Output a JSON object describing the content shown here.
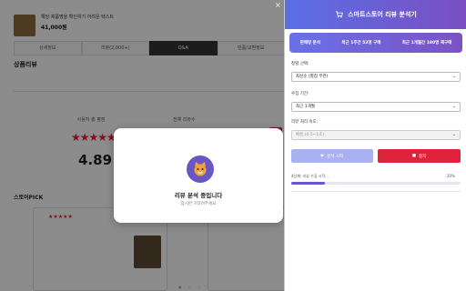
{
  "store": {
    "product_name": "해당 제품명을 확인하기 어려운 텍스트",
    "price": "41,000원",
    "price_sub": "",
    "tabs": [
      {
        "label": "상세정보"
      },
      {
        "label": "리뷰(2,000+)"
      },
      {
        "label": "Q&A"
      },
      {
        "label": "반품/교환정보"
      }
    ],
    "section_title": "상품리뷰",
    "section_desc": "",
    "rating_label": "사용자 총 평점",
    "rating_sub": "",
    "rating_score": "4.89",
    "stars": "★★★★★",
    "distribution_label": "전체 리뷰수",
    "pick_title": "스토어PICK",
    "reviews": [
      {
        "stars": "★★★★★",
        "text": ""
      },
      {
        "stars": "",
        "text": ""
      }
    ]
  },
  "modal": {
    "icon": "cat-icon",
    "title": "리뷰 분석 중입니다",
    "subtitle": "잠시만 기다려주세요"
  },
  "panel": {
    "title": "스마트스토어 리뷰 분석기",
    "header_icon": "cart-icon",
    "stats": [
      "판매량 분석",
      "최근 1주간 53명 구매",
      "최근 1개월간 180명 재구매"
    ],
    "sort_label": "정렬 선택:",
    "sort_value": "최신순 (별점 무관)",
    "period_label": "수집 기간:",
    "period_value": "최근 1개월",
    "speed_label": "리뷰 처리 속도:",
    "speed_value": "빠름 (0.5~1초)",
    "start_button": "분석 시작",
    "stop_button": "중지",
    "progress_label": "4단계: 리뷰 수집 시작...",
    "progress_pct": "20%",
    "progress_value": 0.2
  },
  "colors": {
    "accent": "#6558d0",
    "stop": "#e0233d",
    "star": "#e0262c"
  }
}
